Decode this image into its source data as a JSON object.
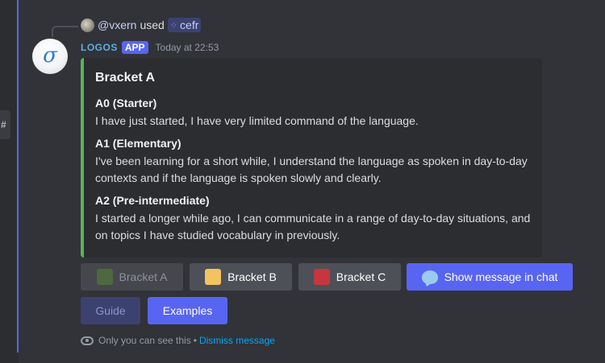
{
  "left_strip": {
    "channel_icon": "#"
  },
  "reply": {
    "username": "@vxern",
    "action": "used",
    "command_icon": "slash-command-icon",
    "command": "cefr"
  },
  "message": {
    "author": "LOGOS",
    "badge": "APP",
    "timestamp": "Today at 22:53",
    "avatar_glyph": "σ",
    "embed": {
      "accent_color": "#57b65a",
      "title": "Bracket A",
      "fields": [
        {
          "name": "A0 (Starter)",
          "value": "I have just started, I have very limited command of the language."
        },
        {
          "name": "A1 (Elementary)",
          "value": "I've been learning for a short while, I understand the language as spoken in day-to-day contexts and if the language is spoken slowly and clearly."
        },
        {
          "name": "A2 (Pre-intermediate)",
          "value": "I started a longer while ago, I can communicate in a range of day-to-day situations, and on topics I have studied vocabulary in previously."
        }
      ]
    }
  },
  "buttons": {
    "bracket_a": {
      "label": "Bracket A",
      "color": "#4c6a3e",
      "disabled": true
    },
    "bracket_b": {
      "label": "Bracket B",
      "color": "#f3c261"
    },
    "bracket_c": {
      "label": "Bracket C",
      "color": "#c7363d"
    },
    "show_in_chat": {
      "label": "Show message in chat",
      "icon": "speech-bubble-icon"
    },
    "guide": {
      "label": "Guide",
      "disabled": true
    },
    "examples": {
      "label": "Examples"
    }
  },
  "ephemeral": {
    "notice": "Only you can see this",
    "separator": "•",
    "dismiss": "Dismiss message"
  }
}
